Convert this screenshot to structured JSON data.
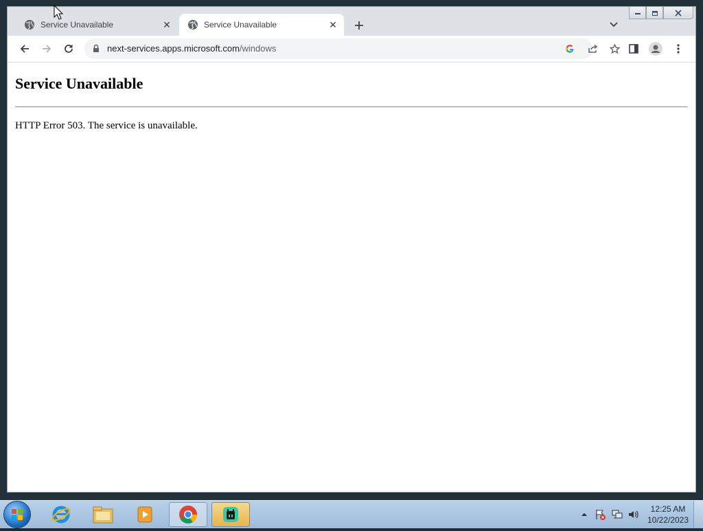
{
  "browser": {
    "tabs": [
      {
        "title": "Service Unavailable",
        "active": false
      },
      {
        "title": "Service Unavailable",
        "active": true
      }
    ],
    "address": {
      "host": "next-services.apps.microsoft.com",
      "path": "/windows"
    }
  },
  "page": {
    "heading": "Service Unavailable",
    "message": "HTTP Error 503. The service is unavailable."
  },
  "taskbar": {
    "clock_time": "12:25 AM",
    "clock_date": "10/22/2023",
    "pinned": [
      "internet-explorer-icon",
      "file-explorer-icon",
      "media-player-icon",
      "chrome-icon",
      "app-icon"
    ]
  },
  "colors": {
    "tabstrip": "#dee1e6",
    "omnibox": "#f1f3f4",
    "taskbar": "#b9d1ea"
  }
}
